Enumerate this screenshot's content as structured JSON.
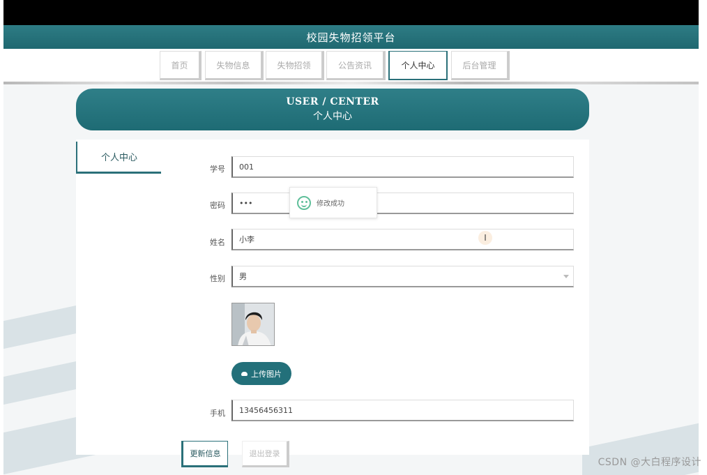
{
  "header": {
    "title": "校园失物招领平台"
  },
  "nav": {
    "items": [
      {
        "label": "首页",
        "active": false
      },
      {
        "label": "失物信息",
        "active": false
      },
      {
        "label": "失物招领",
        "active": false
      },
      {
        "label": "公告资讯",
        "active": false
      },
      {
        "label": "个人中心",
        "active": true
      },
      {
        "label": "后台管理",
        "active": false
      }
    ]
  },
  "banner": {
    "en": "USER / CENTER",
    "cn": "个人中心"
  },
  "sidebar": {
    "tab_label": "个人中心"
  },
  "form": {
    "student_id": {
      "label": "学号",
      "value": "001"
    },
    "password": {
      "label": "密码",
      "value": "•••"
    },
    "name": {
      "label": "姓名",
      "value": "小李"
    },
    "gender": {
      "label": "性别",
      "value": "男"
    },
    "phone": {
      "label": "手机",
      "value": "13456456311"
    }
  },
  "toast": {
    "message": "修改成功"
  },
  "cursor": {
    "glyph": "I"
  },
  "upload": {
    "label": "上传图片"
  },
  "buttons": {
    "update": "更新信息",
    "logout": "退出登录"
  },
  "watermark": "CSDN @大白程序设计",
  "colors": {
    "accent": "#23707a",
    "header": "#2a7079",
    "toast_icon": "#5fbf9a"
  }
}
